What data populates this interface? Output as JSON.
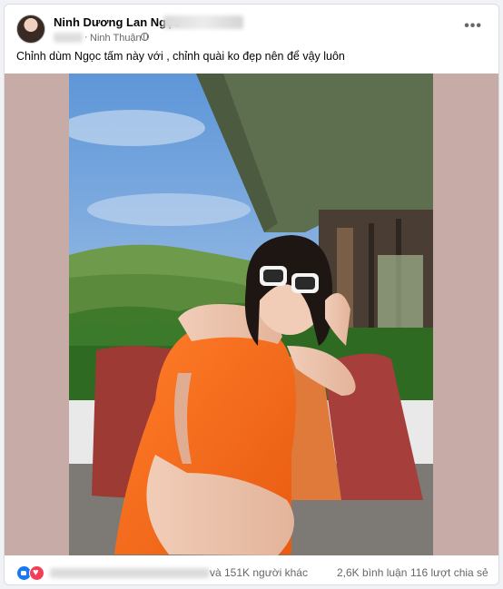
{
  "post": {
    "author_name": "Ninh Dương Lan Ngọc",
    "location": "Ninh Thuận",
    "meta_separator": "·",
    "more_button_label": "•••",
    "caption": "Chỉnh dùm Ngọc tấm này với , chỉnh quài ko đẹp nên để vậy luôn",
    "photo_icon": "photo-woman-orange-dress",
    "reactions": [
      "like-icon",
      "love-icon"
    ],
    "reaction_count_text": "và 151K người khác",
    "comment_count_text": "2,6K bình luận",
    "share_count_text": "116 lượt chia sẻ"
  },
  "colors": {
    "media_background": "#c7aba6",
    "like": "#1877f2",
    "love": "#f33e58",
    "secondary_text": "#65676b"
  }
}
